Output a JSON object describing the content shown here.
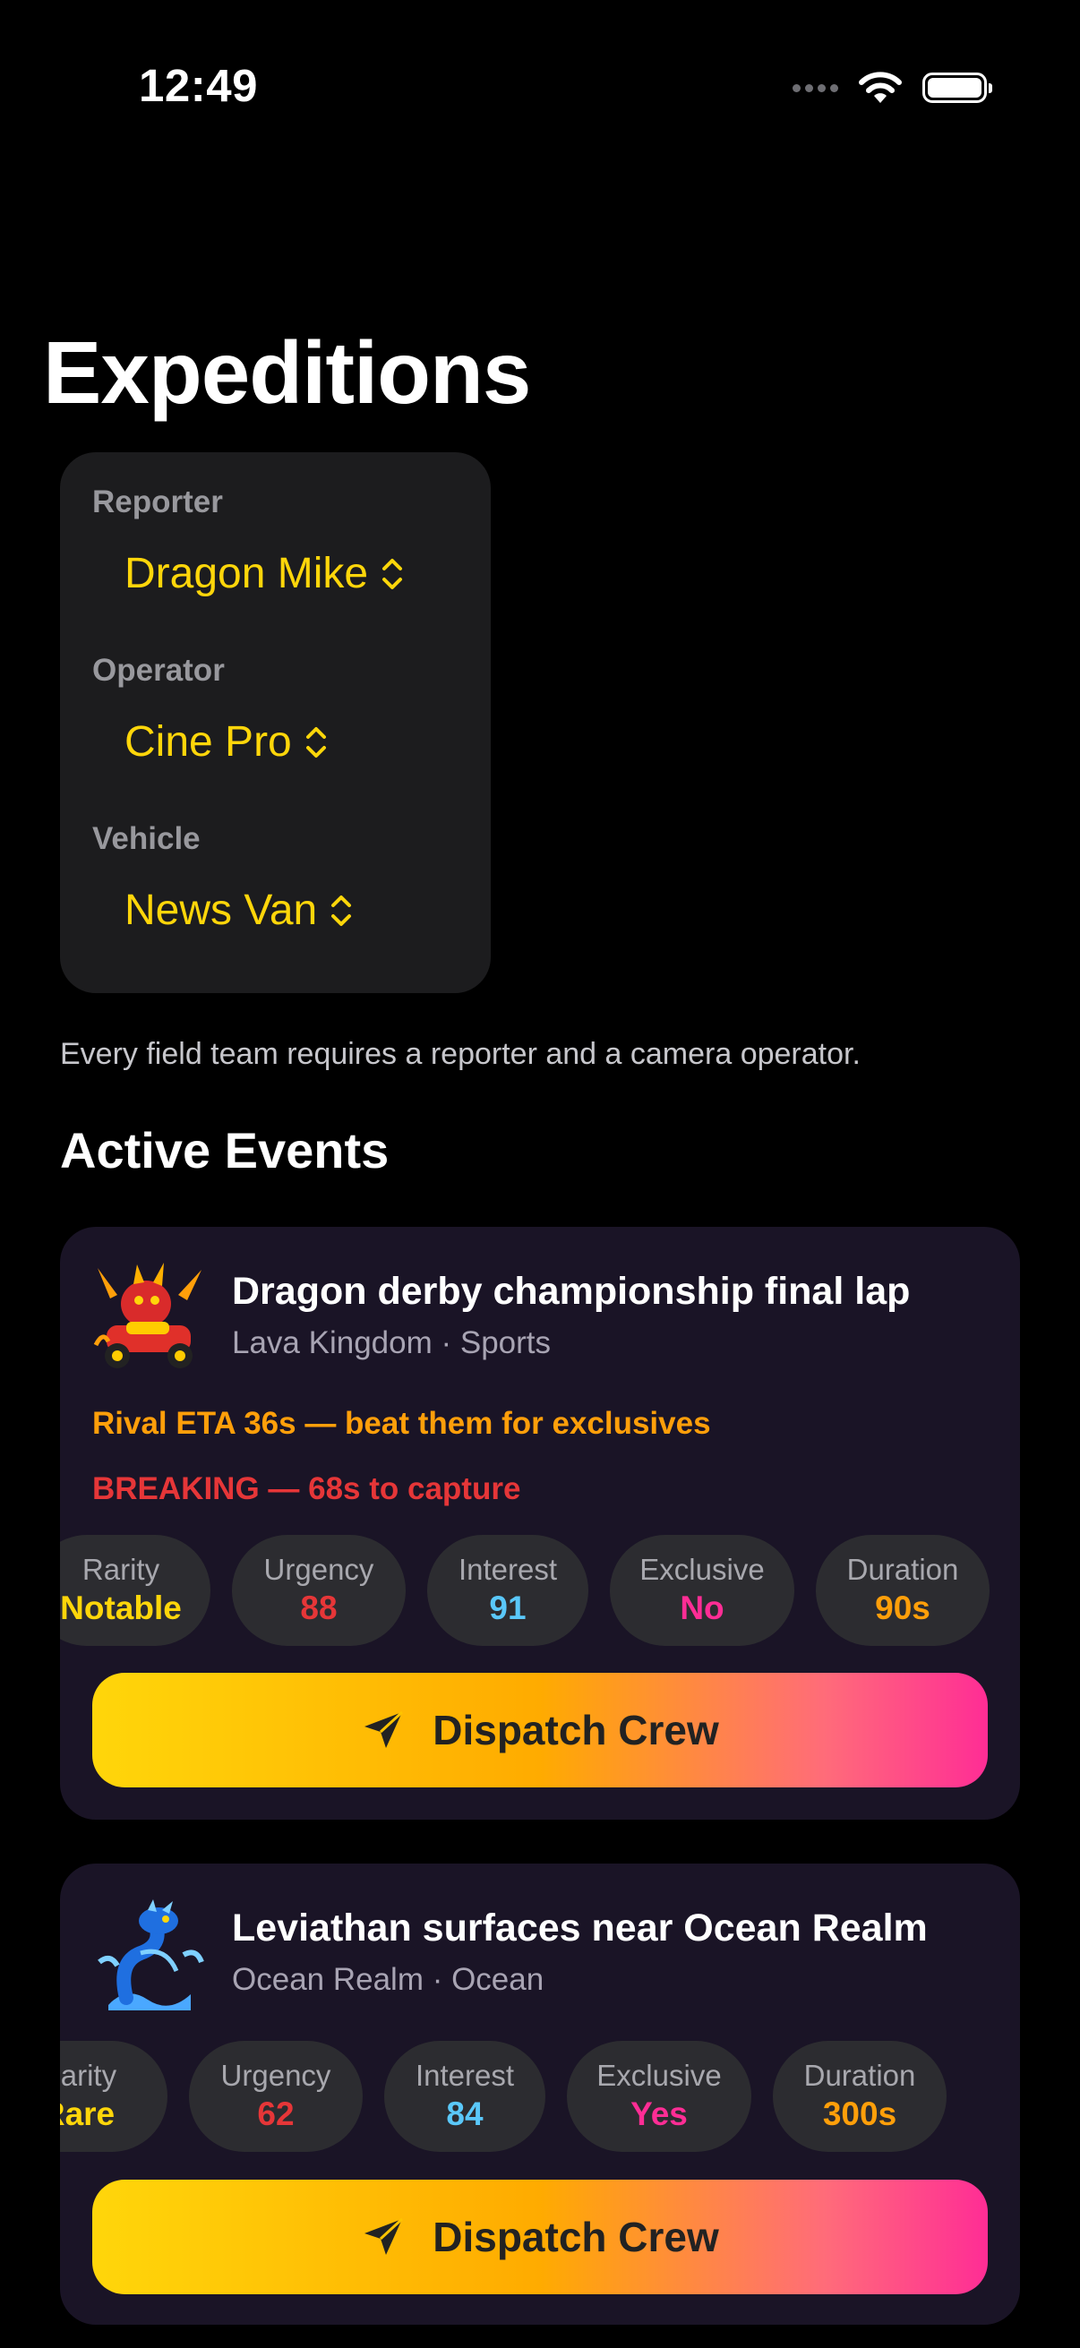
{
  "status_bar": {
    "time": "12:49"
  },
  "page": {
    "title": "Expeditions"
  },
  "team": {
    "reporter_label": "Reporter",
    "reporter_value": "Dragon Mike",
    "operator_label": "Operator",
    "operator_value": "Cine Pro",
    "vehicle_label": "Vehicle",
    "vehicle_value": "News Van",
    "helper_text": "Every field team requires a reporter and a camera operator."
  },
  "section_title": "Active Events",
  "colors": {
    "accent_yellow": "#ffd60a",
    "rarity_color": "#ffd60a",
    "urgency_color": "#e63638",
    "interest_color": "#5ac8fa",
    "exclusive_color": "#ff2d95",
    "duration_color": "#ff9f0a",
    "rival_color": "#ff9f0a",
    "breaking_color": "#e63638"
  },
  "events": [
    {
      "icon": "dragon-kart-icon",
      "title": "Dragon derby championship final lap",
      "subtitle": "Lava Kingdom · Sports",
      "rival": "Rival ETA 36s — beat them for exclusives",
      "breaking": "BREAKING — 68s to capture",
      "stats": [
        {
          "label": "Rarity",
          "value": "Notable"
        },
        {
          "label": "Urgency",
          "value": "88"
        },
        {
          "label": "Interest",
          "value": "91"
        },
        {
          "label": "Exclusive",
          "value": "No"
        },
        {
          "label": "Duration",
          "value": "90s"
        }
      ],
      "button_label": "Dispatch Crew"
    },
    {
      "icon": "water-dragon-icon",
      "title": "Leviathan surfaces near Ocean Realm",
      "subtitle": "Ocean Realm · Ocean",
      "stats": [
        {
          "label": "Rarity",
          "value": "Rare"
        },
        {
          "label": "Urgency",
          "value": "62"
        },
        {
          "label": "Interest",
          "value": "84"
        },
        {
          "label": "Exclusive",
          "value": "Yes"
        },
        {
          "label": "Duration",
          "value": "300s"
        }
      ],
      "button_label": "Dispatch Crew"
    }
  ]
}
